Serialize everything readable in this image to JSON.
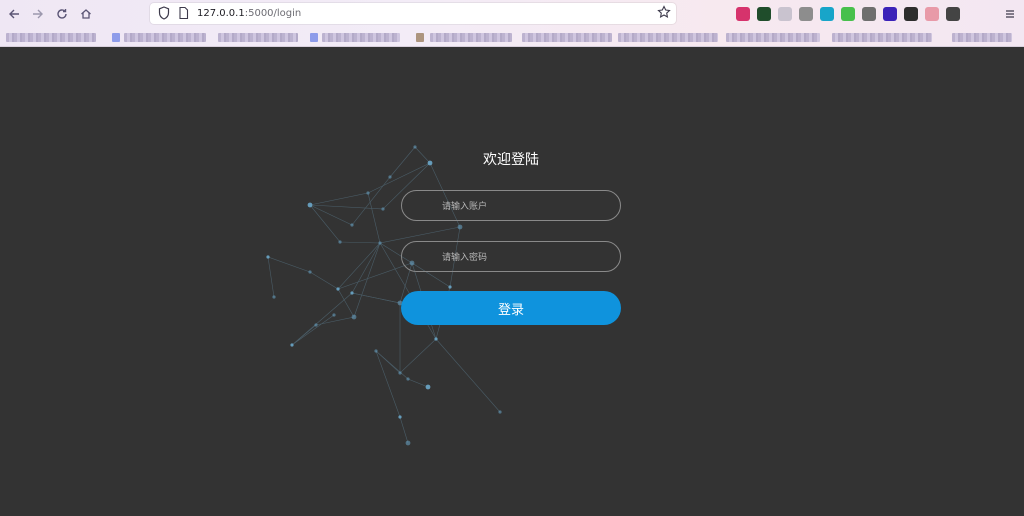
{
  "browser": {
    "url_host": "127.0.0.1",
    "url_path": ":5000/login",
    "extensions": [
      {
        "name": "pocket-icon",
        "color": "#d6336c"
      },
      {
        "name": "extension-dark-green-icon",
        "color": "#1f4d2b"
      },
      {
        "name": "extension-gear-icon",
        "color": "#c9c3cf"
      },
      {
        "name": "extension-ring-icon",
        "color": "#8d8d8d"
      },
      {
        "name": "extension-cyan-icon",
        "color": "#18a5c9"
      },
      {
        "name": "extension-green-icon",
        "color": "#47c04c"
      },
      {
        "name": "extension-grey-icon",
        "color": "#6e6e6e"
      },
      {
        "name": "extension-purple-icon",
        "color": "#3b22b8"
      },
      {
        "name": "extension-se-icon",
        "color": "#2d2d2d"
      },
      {
        "name": "extension-pink-icon",
        "color": "#e89aa8"
      },
      {
        "name": "extension-dark-icon",
        "color": "#444444"
      }
    ]
  },
  "login": {
    "title": "欢迎登陆",
    "account_placeholder": "请输入账户",
    "password_placeholder": "请输入密码",
    "submit_label": "登录"
  },
  "colors": {
    "page_background": "#333333",
    "button_accent": "#0f93dd",
    "network_node": "#6aa6c8"
  }
}
